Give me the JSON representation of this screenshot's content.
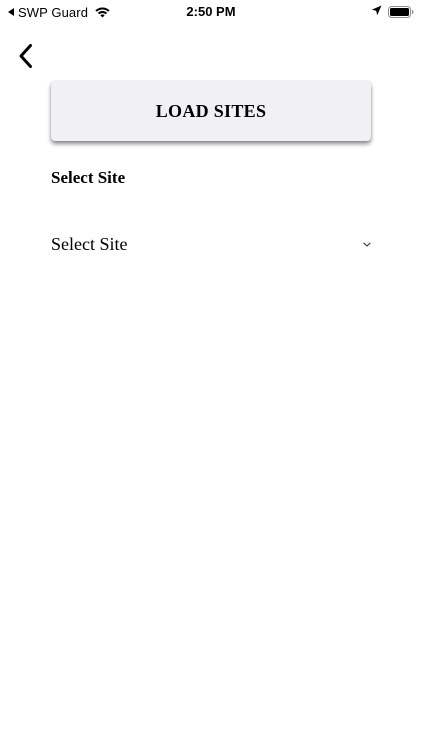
{
  "status_bar": {
    "carrier": "SWP Guard",
    "time": "2:50 PM"
  },
  "header": {
    "back_icon": "chevron-left-icon"
  },
  "actions": {
    "load_sites_label": "LOAD SITES"
  },
  "form": {
    "site_label": "Select Site",
    "site_select": {
      "selected_value": "Select Site",
      "icon": "chevron-down-icon"
    }
  }
}
